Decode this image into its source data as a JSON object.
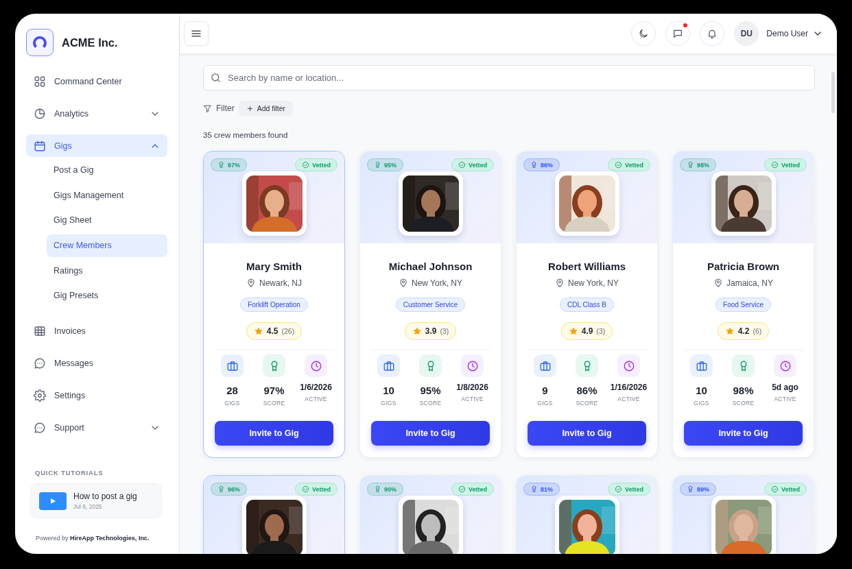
{
  "sidebar": {
    "brand": "ACME Inc.",
    "items": [
      {
        "label": "Command Center",
        "selected": false
      },
      {
        "label": "Analytics",
        "selected": false,
        "expanded": false
      },
      {
        "label": "Gigs",
        "selected": true,
        "expanded": true,
        "children": [
          {
            "label": "Post a Gig",
            "selected": false
          },
          {
            "label": "Gigs Management",
            "selected": false
          },
          {
            "label": "Gig Sheet",
            "selected": false
          },
          {
            "label": "Crew Members",
            "selected": true
          },
          {
            "label": "Ratings",
            "selected": false
          },
          {
            "label": "Gig Presets",
            "selected": false
          }
        ]
      },
      {
        "label": "Invoices",
        "selected": false
      },
      {
        "label": "Messages",
        "selected": false
      },
      {
        "label": "Settings",
        "selected": false
      },
      {
        "label": "Support",
        "selected": false,
        "expanded": false
      }
    ],
    "tutorials_heading": "QUICK TUTORIALS",
    "tutorials": [
      {
        "title": "How to post a gig",
        "date": "Jul 6, 2025"
      }
    ],
    "footer": "Powered by **HireApp Technologies, Inc.**"
  },
  "topbar": {
    "messages_unread": true,
    "user_initials": "DU",
    "user_name": "Demo User"
  },
  "search": {
    "placeholder": "Search by name or location..."
  },
  "filter": {
    "label": "Filter",
    "add_label": "Add filter"
  },
  "result_count": "35 crew members found",
  "crew": [
    {
      "selected": true,
      "score_badge": "97%",
      "color": "#0f9a6c",
      "vetted": "Vetted",
      "name": "Mary Smith",
      "location": "Newark, NJ",
      "skill": "Forklift Operation",
      "rating": "4.5",
      "reviews": "(26)",
      "stats": [
        {
          "kind": "gigs",
          "value": "28",
          "label": "GIGS"
        },
        {
          "kind": "score",
          "value": "97%",
          "label": "SCORE"
        },
        {
          "kind": "active",
          "value": "1/6/2026",
          "label": "ACTIVE"
        }
      ],
      "action": "Invite to Gig"
    },
    {
      "selected": false,
      "score_badge": "95%",
      "color": "#0f9a6c",
      "vetted": "Vetted",
      "name": "Michael Johnson",
      "location": "New York, NY",
      "skill": "Customer Service",
      "rating": "3.9",
      "reviews": "(3)",
      "stats": [
        {
          "kind": "gigs",
          "value": "10",
          "label": "GIGS"
        },
        {
          "kind": "score",
          "value": "95%",
          "label": "SCORE"
        },
        {
          "kind": "active",
          "value": "1/8/2026",
          "label": "ACTIVE"
        }
      ],
      "action": "Invite to Gig"
    },
    {
      "selected": false,
      "score_badge": "86%",
      "color": "#2f55e8",
      "vetted": "Vetted",
      "name": "Robert Williams",
      "location": "New York, NY",
      "skill": "CDL Class B",
      "rating": "4.9",
      "reviews": "(3)",
      "stats": [
        {
          "kind": "gigs",
          "value": "9",
          "label": "GIGS"
        },
        {
          "kind": "score",
          "value": "86%",
          "label": "SCORE"
        },
        {
          "kind": "active",
          "value": "1/16/2026",
          "label": "ACTIVE"
        }
      ],
      "action": "Invite to Gig"
    },
    {
      "selected": false,
      "score_badge": "98%",
      "color": "#0f9a6c",
      "vetted": "Vetted",
      "name": "Patricia Brown",
      "location": "Jamaica, NY",
      "skill": "Food Service",
      "rating": "4.2",
      "reviews": "(6)",
      "stats": [
        {
          "kind": "gigs",
          "value": "10",
          "label": "GIGS"
        },
        {
          "kind": "score",
          "value": "98%",
          "label": "SCORE"
        },
        {
          "kind": "active",
          "value": "5d ago",
          "label": "ACTIVE"
        }
      ],
      "action": "Invite to Gig"
    },
    {
      "selected": true,
      "score_badge": "96%",
      "color": "#0f9a6c",
      "vetted": "Vetted"
    },
    {
      "selected": false,
      "score_badge": "90%",
      "color": "#0f9a6c",
      "vetted": "Vetted"
    },
    {
      "selected": false,
      "score_badge": "81%",
      "color": "#2f55e8",
      "vetted": "Vetted"
    },
    {
      "selected": false,
      "score_badge": "89%",
      "color": "#2f55e8",
      "vetted": "Vetted"
    }
  ]
}
